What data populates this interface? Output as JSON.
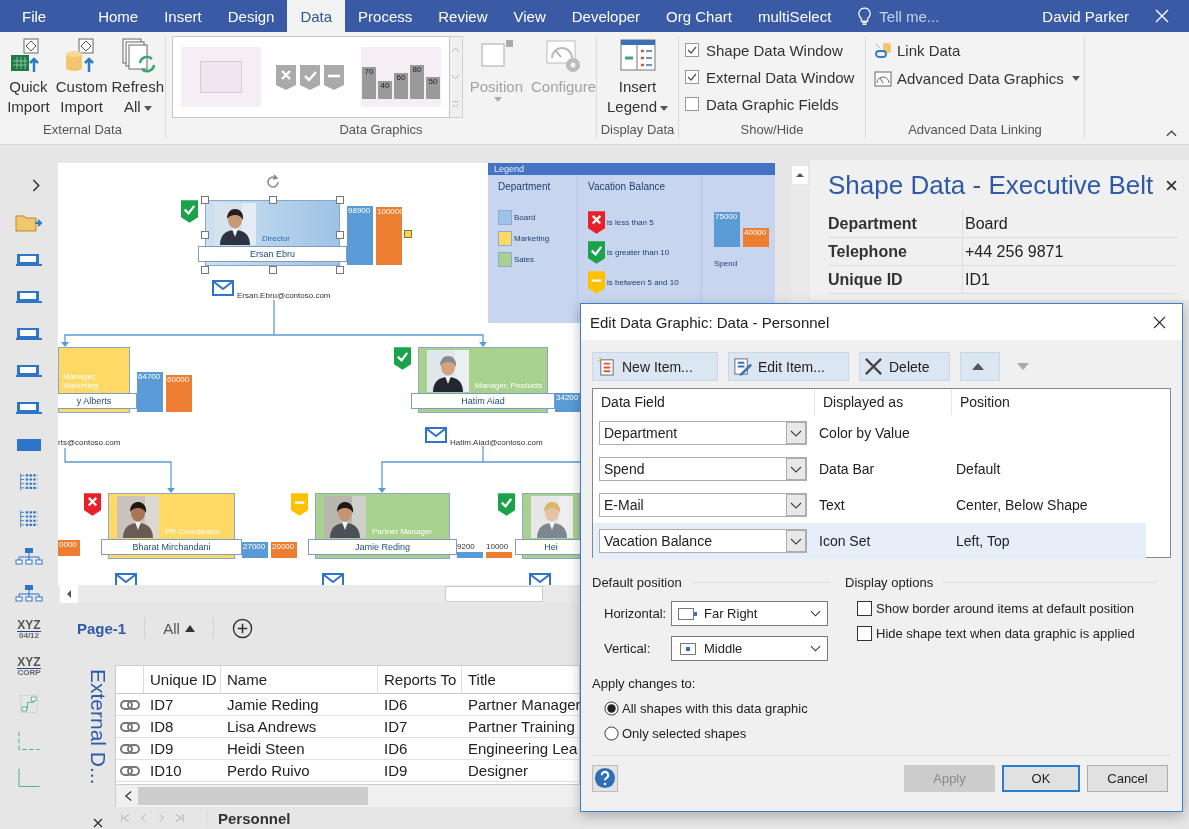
{
  "title_bar": {
    "tabs": [
      {
        "label": "File",
        "selected": false
      },
      {
        "label": "Home",
        "selected": false
      },
      {
        "label": "Insert",
        "selected": false
      },
      {
        "label": "Design",
        "selected": false
      },
      {
        "label": "Data",
        "selected": true
      },
      {
        "label": "Process",
        "selected": false
      },
      {
        "label": "Review",
        "selected": false
      },
      {
        "label": "View",
        "selected": false
      },
      {
        "label": "Developer",
        "selected": false
      },
      {
        "label": "Org Chart",
        "selected": false
      },
      {
        "label": "multiSelect",
        "selected": false
      }
    ],
    "tell_me": {
      "placeholder": "Tell me..."
    },
    "user": "David Parker"
  },
  "ribbon": {
    "external_data": {
      "label": "External Data",
      "buttons": [
        {
          "label": "Quick Import",
          "kind": "excel",
          "dropdown": false
        },
        {
          "label": "Custom Import",
          "kind": "database",
          "dropdown": false
        },
        {
          "label": "Refresh All",
          "kind": "refresh",
          "dropdown": true
        }
      ]
    },
    "data_graphics": {
      "label": "Data Graphics",
      "gallery_bar_labels": [
        "70",
        "40",
        "60",
        "80",
        "50"
      ],
      "buttons": [
        {
          "label": "Position",
          "kind": "position",
          "disabled": true,
          "dropdown": true
        },
        {
          "label": "Configure",
          "kind": "configure",
          "disabled": true,
          "dropdown": false
        }
      ]
    },
    "display_data": {
      "label": "Display Data",
      "button": {
        "label": "Insert Legend",
        "dropdown": true
      }
    },
    "show_hide": {
      "label": "Show/Hide",
      "checkboxes": [
        {
          "label": "Shape Data Window",
          "checked": true
        },
        {
          "label": "External Data Window",
          "checked": true
        },
        {
          "label": "Data Graphic Fields",
          "checked": false
        }
      ]
    },
    "advanced": {
      "label": "Advanced Data Linking",
      "buttons": [
        {
          "label": "Link Data",
          "kind": "link",
          "dropdown": false
        },
        {
          "label": "Advanced Data Graphics",
          "kind": "gauge",
          "dropdown": true
        }
      ]
    }
  },
  "stencil": [
    {
      "top": "XYZ",
      "bottom": "04/12"
    },
    {
      "top": "XYZ",
      "bottom": "CORP"
    }
  ],
  "canvas": {
    "legend": {
      "title": "Legend",
      "columns": [
        "Department",
        "Vacation Balance"
      ],
      "departments": [
        {
          "label": "Board",
          "color": "#9dc3e6"
        },
        {
          "label": "Marketing",
          "color": "#ffd966"
        },
        {
          "label": "Sales",
          "color": "#a9d18e"
        }
      ],
      "icons": [
        {
          "kind": "cross",
          "label": "is less than 5"
        },
        {
          "kind": "check",
          "label": "is greater than 10"
        },
        {
          "kind": "dash",
          "label": "is between 5 and 10"
        }
      ],
      "bars": [
        {
          "label": "75000",
          "color": "#5b9bd5"
        },
        {
          "label": "40000",
          "color": "#ed7d31"
        }
      ],
      "bar_caption": "Spend"
    },
    "nodes": [
      {
        "title": "Director",
        "name": "Ersan Ebru",
        "email": "Ersan.Ebru@contoso.com",
        "color": "#9dc3e6",
        "badge": {
          "kind": "check"
        },
        "photo": true,
        "mail_icon": true,
        "selected": true,
        "bars": [
          {
            "label": "98900",
            "color": "#5b9bd5"
          },
          {
            "label": "100000",
            "color": "#ed7d31"
          }
        ]
      },
      {
        "title": "Manager, Marketing",
        "name": "y Alberts",
        "email": "rts@contoso.com",
        "color": "#ffd966",
        "photo": false,
        "selected": false,
        "bars": [
          {
            "label": "64700",
            "color": "#5b9bd5"
          },
          {
            "label": "60000",
            "color": "#ed7d31"
          }
        ]
      },
      {
        "title": "Manager, Products",
        "name": "Hatim Aiad",
        "email": "Hatim.Aiad@contoso.com",
        "color": "#a9d18e",
        "badge": {
          "kind": "check"
        },
        "photo": true,
        "mail_icon": true,
        "selected": false,
        "bars": [
          {
            "label": "34200",
            "color": "#5b9bd5"
          }
        ]
      },
      {
        "title": "PR Coordinator",
        "name": "Bharat Mirchandani",
        "color": "#ffd966",
        "badge": {
          "kind": "cross"
        },
        "photo": true,
        "mail_icon": true,
        "selected": false,
        "bars": [
          {
            "label": "27000",
            "color": "#5b9bd5"
          },
          {
            "label": "20000",
            "color": "#ed7d31"
          }
        ]
      },
      {
        "title": "Partner Manager",
        "name": "Jamie Reding",
        "color": "#a9d18e",
        "badge": {
          "kind": "dash"
        },
        "photo": true,
        "mail_icon": true,
        "selected": false,
        "bars": [
          {
            "label": "9200",
            "color": "#5b9bd5"
          },
          {
            "label": "10000",
            "color": "#ed7d31"
          }
        ]
      },
      {
        "name": "Hei",
        "color": "#a9d18e",
        "badge": {
          "kind": "check"
        },
        "photo": true,
        "mail_icon": true,
        "selected": false
      }
    ],
    "edge_bars": [
      {
        "label": "0000",
        "color": "#ed7d31"
      }
    ]
  },
  "pages": {
    "tabs": [
      {
        "label": "Page-1",
        "selected": true
      }
    ],
    "filter": "All"
  },
  "external_data": {
    "title": "External D...",
    "columns": [
      "Unique ID",
      "Name",
      "Reports To",
      "Title"
    ],
    "rows": [
      {
        "linked": true,
        "cells": [
          "ID7",
          "Jamie Reding",
          "ID6",
          "Partner Manager"
        ]
      },
      {
        "linked": true,
        "cells": [
          "ID8",
          "Lisa Andrews",
          "ID7",
          "Partner Training"
        ]
      },
      {
        "linked": true,
        "cells": [
          "ID9",
          "Heidi Steen",
          "ID6",
          "Engineering Lea"
        ]
      },
      {
        "linked": true,
        "cells": [
          "ID10",
          "Perdo Ruivo",
          "ID9",
          "Designer"
        ]
      }
    ],
    "sheets": [
      {
        "label": "Personnel",
        "selected": true
      }
    ]
  },
  "shape_data": {
    "title": "Shape Data - Executive Belt",
    "rows": [
      {
        "label": "Department",
        "value": "Board"
      },
      {
        "label": "Telephone",
        "value": "+44 256 9871"
      },
      {
        "label": "Unique ID",
        "value": "ID1"
      }
    ]
  },
  "dialog": {
    "title": "Edit Data Graphic: Data - Personnel",
    "toolbar": [
      {
        "kind": "new",
        "label": "New Item...",
        "disabled": false
      },
      {
        "kind": "edit",
        "label": "Edit Item...",
        "disabled": false
      },
      {
        "kind": "delete",
        "label": "Delete",
        "disabled": false
      },
      {
        "kind": "up",
        "disabled": false
      },
      {
        "kind": "down",
        "disabled": true
      }
    ],
    "columns": [
      "Data Field",
      "Displayed as",
      "Position"
    ],
    "items": [
      {
        "field": "Department",
        "displayed_as": "Color by Value",
        "selected": false
      },
      {
        "field": "Spend",
        "displayed_as": "Data Bar",
        "position": "Default",
        "selected": false
      },
      {
        "field": "E-Mail",
        "displayed_as": "Text",
        "position": "Center, Below Shape",
        "selected": false
      },
      {
        "field": "Vacation Balance",
        "displayed_as": "Icon Set",
        "position": "Left, Top",
        "selected": true
      }
    ],
    "default_position": {
      "title": "Default position",
      "fields": [
        {
          "label": "Horizontal:",
          "value": "Far Right",
          "kind": "far-right"
        },
        {
          "label": "Vertical:",
          "value": "Middle",
          "kind": "middle"
        }
      ]
    },
    "display_options": {
      "title": "Display options",
      "checkboxes": [
        {
          "label": "Show border around items at default position",
          "checked": false
        },
        {
          "label": "Hide shape text when data graphic is applied",
          "checked": false
        }
      ]
    },
    "apply_to": {
      "title": "Apply changes to:",
      "options": [
        {
          "label": "All shapes with this data graphic",
          "selected": true
        },
        {
          "label": "Only selected shapes",
          "selected": false
        }
      ]
    },
    "buttons": [
      {
        "label": "Apply",
        "disabled": true,
        "default": false
      },
      {
        "label": "OK",
        "disabled": false,
        "default": true
      },
      {
        "label": "Cancel",
        "disabled": false,
        "default": false
      }
    ]
  }
}
